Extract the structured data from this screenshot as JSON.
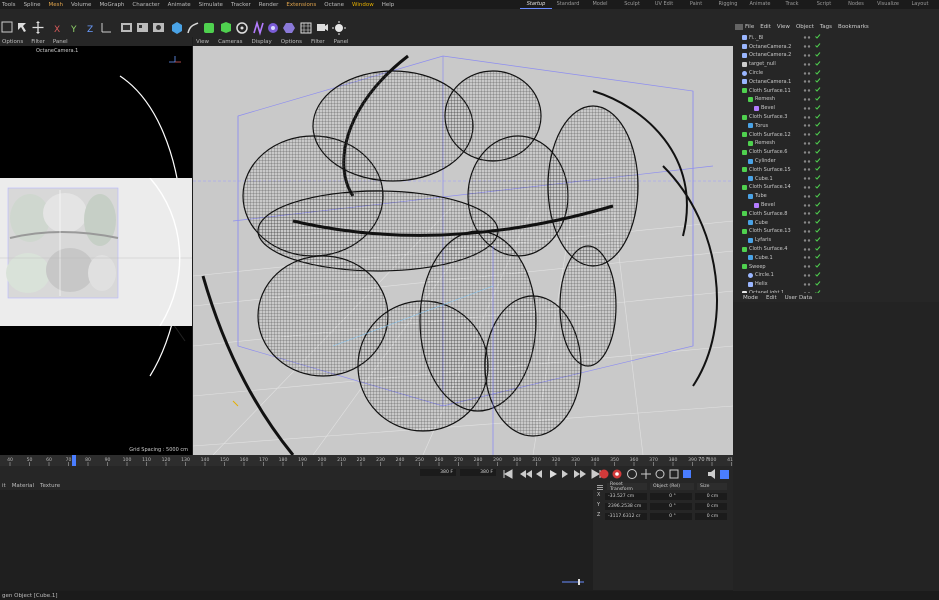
{
  "menubar": {
    "items": [
      "Tools",
      "Spline",
      "Mesh",
      "Volume",
      "MoGraph",
      "Character",
      "Animate",
      "Simulate",
      "Tracker",
      "Render",
      "Extensions",
      "Octane",
      "Window",
      "Help"
    ],
    "layouts": [
      "Startup",
      "Standard",
      "Model",
      "Sculpt",
      "UV Edit",
      "Paint",
      "Rigging",
      "Animate",
      "Track",
      "Script",
      "Nodes",
      "Visualize",
      "Layout"
    ],
    "active_layout": "Startup"
  },
  "left_viewport": {
    "menu": [
      "Options",
      "Filter",
      "Panel"
    ],
    "camera_label": "OctaneCamera.1",
    "grid_spacing": "Grid Spacing : 5000 cm"
  },
  "main_viewport": {
    "menu": [
      "View",
      "Cameras",
      "Display",
      "Options",
      "Filter",
      "Panel"
    ]
  },
  "object_manager": {
    "menu": [
      "File",
      "Edit",
      "View",
      "Object",
      "Tags",
      "Bookmarks"
    ],
    "rows": [
      {
        "name": "Fi.._Bl",
        "indent": 0,
        "icon": "camera-icon"
      },
      {
        "name": "OctaneCamera.2",
        "indent": 0,
        "icon": "camera-icon"
      },
      {
        "name": "OctaneCamera.2",
        "indent": 0,
        "icon": "camera-icon"
      },
      {
        "name": "target_null",
        "indent": 0,
        "icon": "null-icon"
      },
      {
        "name": "Circle",
        "indent": 0,
        "icon": "circle-spline-icon"
      },
      {
        "name": "OctaneCamera.1",
        "indent": 0,
        "icon": "camera-icon"
      },
      {
        "name": "Cloth Surface.11",
        "indent": 0,
        "icon": "cloth-surface-icon"
      },
      {
        "name": "Remesh",
        "indent": 1,
        "icon": "remesh-icon"
      },
      {
        "name": "Bevel",
        "indent": 2,
        "icon": "bevel-icon"
      },
      {
        "name": "Cloth Surface.3",
        "indent": 0,
        "icon": "cloth-surface-icon"
      },
      {
        "name": "Torus",
        "indent": 1,
        "icon": "torus-icon"
      },
      {
        "name": "Cloth Surface.12",
        "indent": 0,
        "icon": "cloth-surface-icon"
      },
      {
        "name": "Remesh",
        "indent": 1,
        "icon": "remesh-icon"
      },
      {
        "name": "Cloth Surface.6",
        "indent": 0,
        "icon": "cloth-surface-icon"
      },
      {
        "name": "Cylinder",
        "indent": 1,
        "icon": "cylinder-icon"
      },
      {
        "name": "Cloth Surface.15",
        "indent": 0,
        "icon": "cloth-surface-icon"
      },
      {
        "name": "Cube.1",
        "indent": 1,
        "icon": "cube-icon"
      },
      {
        "name": "Cloth Surface.14",
        "indent": 0,
        "icon": "cloth-surface-icon"
      },
      {
        "name": "Tube",
        "indent": 1,
        "icon": "tube-icon"
      },
      {
        "name": "Bevel",
        "indent": 2,
        "icon": "bevel-icon"
      },
      {
        "name": "Cloth Surface.8",
        "indent": 0,
        "icon": "cloth-surface-icon"
      },
      {
        "name": "Cube",
        "indent": 1,
        "icon": "cube-icon"
      },
      {
        "name": "Cloth Surface.13",
        "indent": 0,
        "icon": "cloth-surface-icon"
      },
      {
        "name": "Lyfaris",
        "indent": 1,
        "icon": "object-icon"
      },
      {
        "name": "Cloth Surface.4",
        "indent": 0,
        "icon": "cloth-surface-icon"
      },
      {
        "name": "Cube.1",
        "indent": 1,
        "icon": "cube-icon"
      },
      {
        "name": "Sweep",
        "indent": 0,
        "icon": "sweep-icon"
      },
      {
        "name": "Circle.1",
        "indent": 1,
        "icon": "circle-spline-icon"
      },
      {
        "name": "Helix",
        "indent": 1,
        "icon": "helix-icon"
      },
      {
        "name": "OctaneLight.1",
        "indent": 0,
        "icon": "light-icon"
      }
    ]
  },
  "attributes": {
    "menu": [
      "Mode",
      "Edit",
      "User Data"
    ]
  },
  "timeline": {
    "ticks": [
      "40",
      "50",
      "60",
      "70",
      "80",
      "90",
      "100",
      "110",
      "120",
      "130",
      "140",
      "150",
      "160",
      "170",
      "180",
      "190",
      "200",
      "210",
      "220",
      "230",
      "240",
      "250",
      "260",
      "270",
      "280",
      "290",
      "300",
      "310",
      "320",
      "330",
      "340",
      "350",
      "360",
      "370",
      "380",
      "390",
      "400",
      "410",
      "420",
      "430",
      "440",
      "450",
      "460"
    ],
    "current_frame": "70 F"
  },
  "transport": {
    "start_field": "380 F",
    "end_field": "380 F"
  },
  "material_manager": {
    "menu": [
      "it",
      "Material",
      "Texture"
    ]
  },
  "coordinates": {
    "reset_label": "Reset Transform",
    "mode_dropdown": "Object (Rel)",
    "size_dropdown": "Size",
    "rows": [
      {
        "axis": "X",
        "pos": "-33.527 cm",
        "rot": "0 °",
        "size": "0 cm"
      },
      {
        "axis": "Y",
        "pos": "2396.2538 cm",
        "rot": "0 °",
        "size": "0 cm"
      },
      {
        "axis": "Z",
        "pos": "-3117.6312 cr",
        "rot": "0 °",
        "size": "0 cm"
      }
    ]
  },
  "status": {
    "text": "gen Object [Cube.1]"
  },
  "colors": {
    "accent_orange": "#e0a44c",
    "accent_blue": "#6a8cff",
    "check_green": "#4fd14f",
    "record_red": "#d23a3a"
  }
}
